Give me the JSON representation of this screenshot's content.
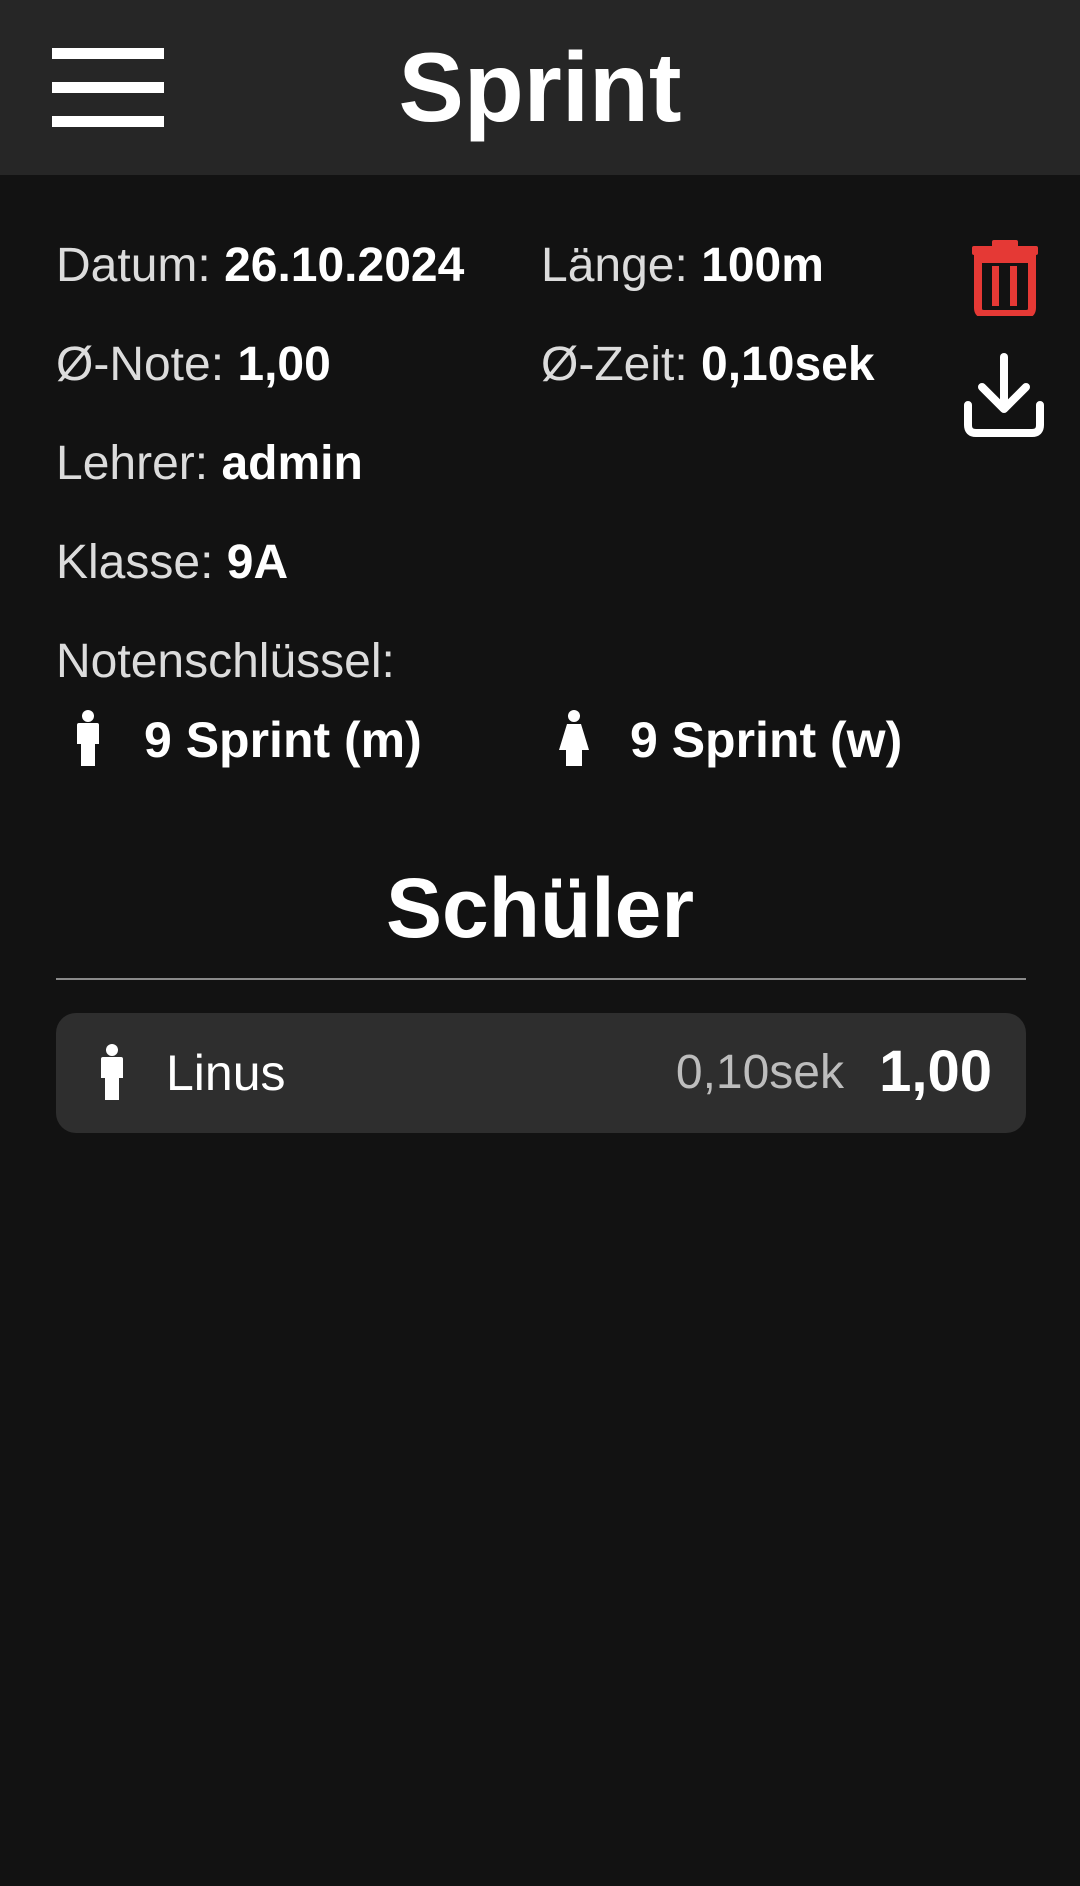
{
  "header": {
    "title": "Sprint",
    "menu_icon": "hamburger-menu-icon"
  },
  "details": {
    "datum_label": "Datum:",
    "datum_value": "26.10.2024",
    "laenge_label": "Länge:",
    "laenge_value": "100m",
    "note_label": "Ø-Note:",
    "note_value": "1,00",
    "zeit_label": "Ø-Zeit:",
    "zeit_value": "0,10sek",
    "lehrer_label": "Lehrer:",
    "lehrer_value": "admin",
    "klasse_label": "Klasse:",
    "klasse_value": "9A",
    "notenschluessel_label": "Notenschlüssel:"
  },
  "grading_keys": [
    {
      "label": "9 Sprint (m)",
      "icon": "male-icon"
    },
    {
      "label": "9 Sprint (w)",
      "icon": "female-icon"
    }
  ],
  "actions": {
    "delete_icon": "trash-icon",
    "download_icon": "download-icon",
    "delete_color": "#e53935"
  },
  "students_section": {
    "title": "Schüler",
    "students": [
      {
        "name": "Linus",
        "time": "0,10sek",
        "grade": "1,00",
        "icon": "male-icon"
      }
    ]
  }
}
